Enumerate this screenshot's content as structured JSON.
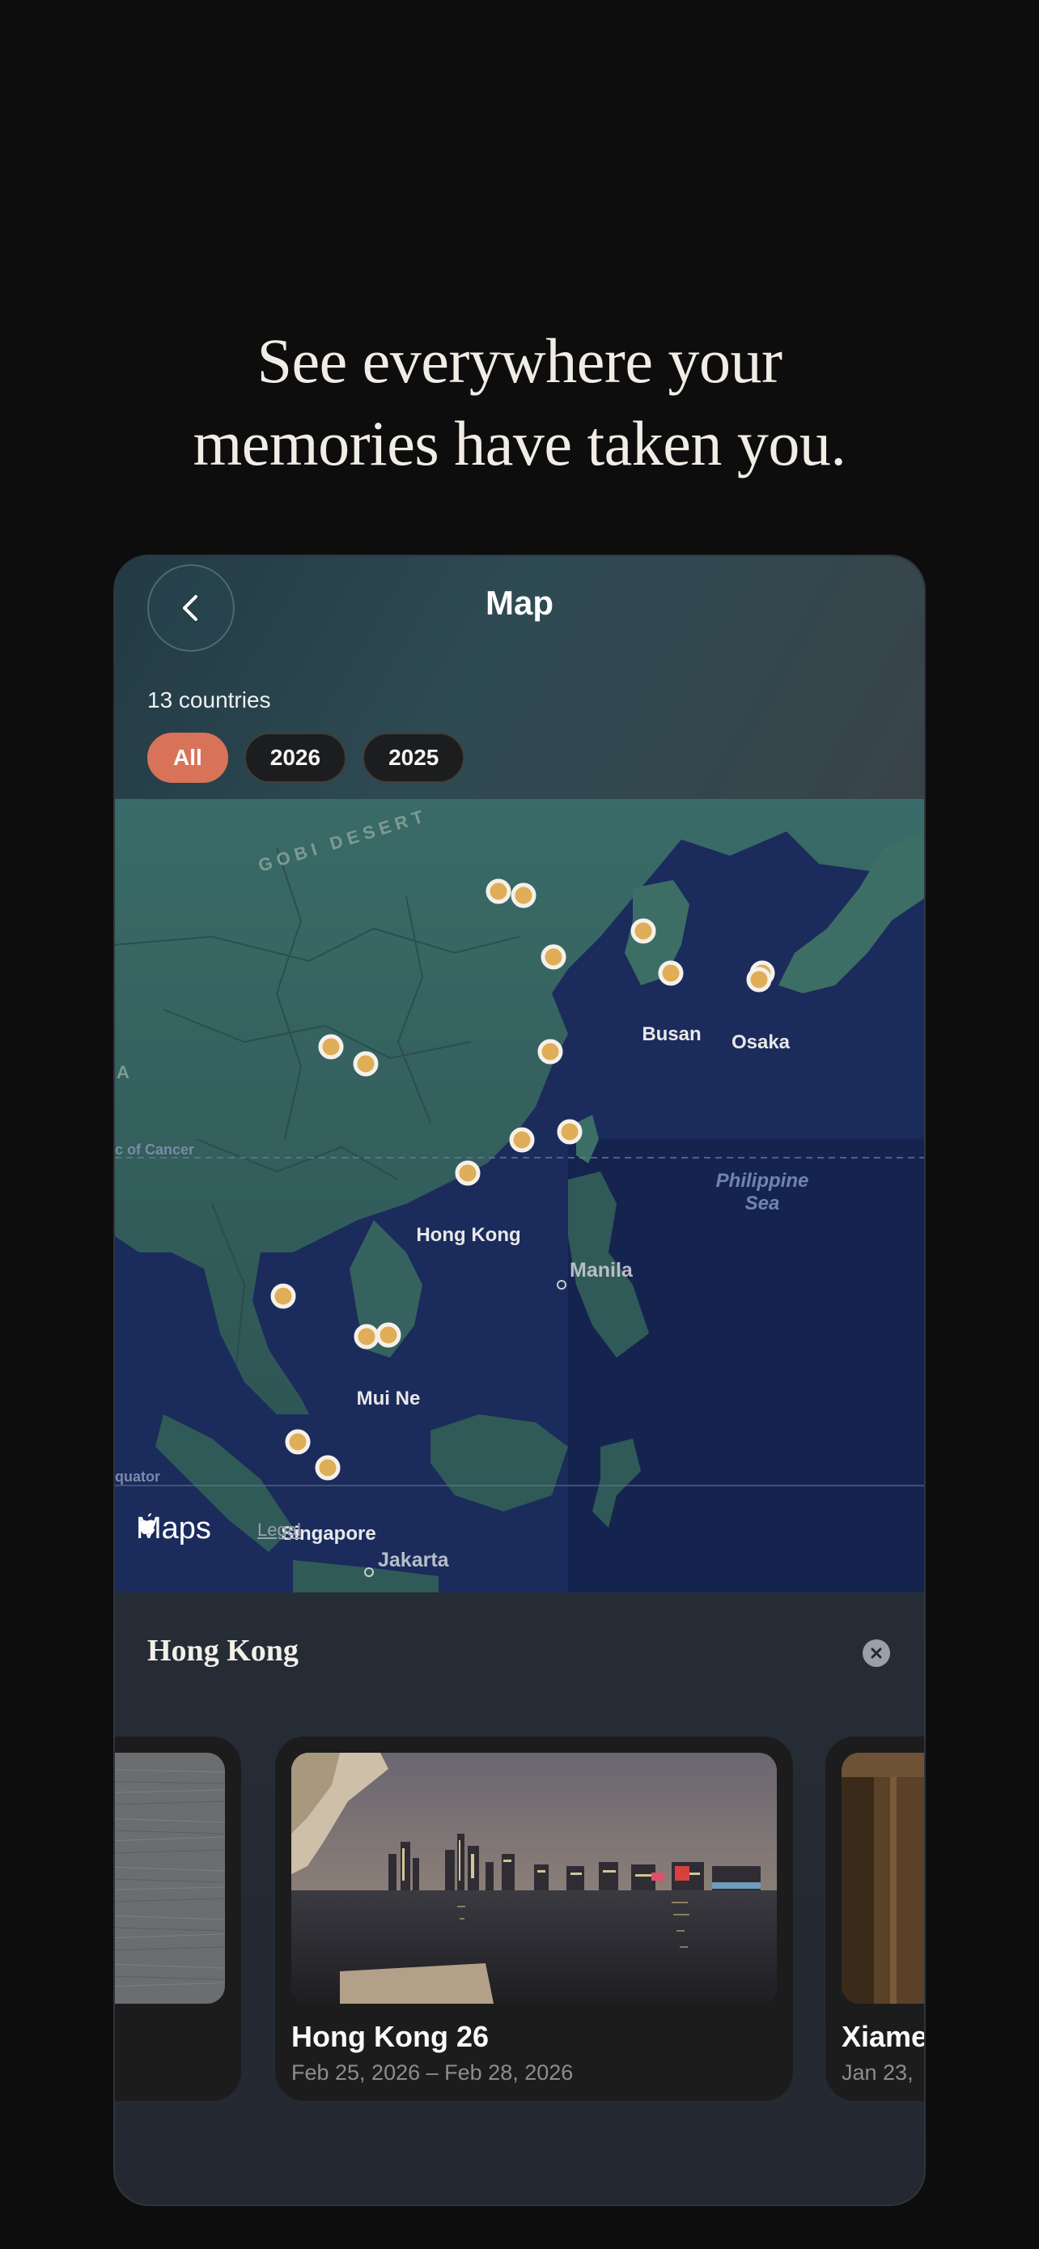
{
  "headline": {
    "line1": "See everywhere your",
    "line2": "memories have taken you."
  },
  "header": {
    "title": "Map",
    "countries": "13 countries"
  },
  "filters": [
    {
      "label": "All",
      "active": true
    },
    {
      "label": "2026",
      "active": false
    },
    {
      "label": "2025",
      "active": false
    }
  ],
  "map": {
    "labels": {
      "gobi": "GOBI DESERT",
      "busan": "Busan",
      "osaka": "Osaka",
      "philippine_sea_1": "Philippine",
      "philippine_sea_2": "Sea",
      "tropic": "c of Cancer",
      "hong_kong": "Hong Kong",
      "manila": "Manila",
      "mui_ne": "Mui Ne",
      "equator": "quator",
      "singapore": "Singapore",
      "jakarta": "Jakarta",
      "a_edge": "A"
    },
    "attribution": "Maps",
    "legal": "Legal",
    "pin_color": "#e0ad58"
  },
  "sheet": {
    "title": "Hong Kong"
  },
  "cards": [
    {
      "title": "",
      "date": ""
    },
    {
      "title": "Hong Kong 26",
      "date": "Feb 25, 2026 – Feb 28, 2026"
    },
    {
      "title": "Xiame",
      "date": "Jan 23,"
    }
  ],
  "icons": {
    "back": "chevron-left-icon",
    "close": "close-icon",
    "logo": "apple-logo-icon"
  }
}
